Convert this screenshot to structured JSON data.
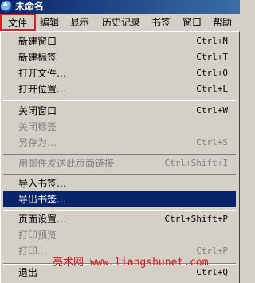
{
  "window": {
    "title": "未命名"
  },
  "menubar": {
    "items": [
      "文件",
      "编辑",
      "显示",
      "历史记录",
      "书签",
      "窗口",
      "帮助"
    ]
  },
  "file_menu": {
    "items": [
      {
        "label": "新建窗口",
        "shortcut": "Ctrl+N",
        "enabled": true
      },
      {
        "label": "新建标签",
        "shortcut": "Ctrl+T",
        "enabled": true
      },
      {
        "label": "打开文件…",
        "shortcut": "Ctrl+O",
        "enabled": true
      },
      {
        "label": "打开位置…",
        "shortcut": "Ctrl+L",
        "enabled": true
      },
      {
        "label": "关闭窗口",
        "shortcut": "Ctrl+W",
        "enabled": true
      },
      {
        "label": "关闭标签",
        "shortcut": "",
        "enabled": false
      },
      {
        "label": "另存为…",
        "shortcut": "Ctrl+S",
        "enabled": false
      },
      {
        "label": "用邮件发送此页面链接",
        "shortcut": "Ctrl+Shift+I",
        "enabled": false
      },
      {
        "label": "导入书签…",
        "shortcut": "",
        "enabled": true
      },
      {
        "label": "导出书签…",
        "shortcut": "",
        "enabled": true,
        "selected": true
      },
      {
        "label": "页面设置…",
        "shortcut": "Ctrl+Shift+P",
        "enabled": true
      },
      {
        "label": "打印预览",
        "shortcut": "",
        "enabled": false
      },
      {
        "label": "打印…",
        "shortcut": "Ctrl+P",
        "enabled": false
      },
      {
        "label": "退出",
        "shortcut": "Ctrl+Q",
        "enabled": true
      }
    ]
  },
  "watermark": {
    "text": "亮术网 www.liangshunet.com"
  },
  "colors": {
    "selection": "#0a246a",
    "highlight_border": "#e02020",
    "menu_bg": "#d4d0c8"
  }
}
